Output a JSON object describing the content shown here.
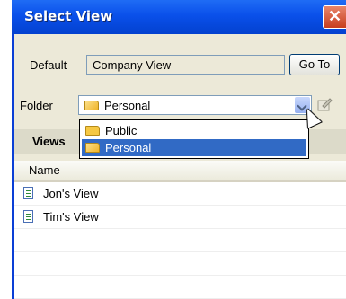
{
  "window": {
    "title": "Select View",
    "close_glyph": "✕"
  },
  "default": {
    "label": "Default",
    "value": "Company View",
    "goto_button": "Go To"
  },
  "folder": {
    "label": "Folder",
    "selected": "Personal",
    "options": [
      {
        "label": "Public"
      },
      {
        "label": "Personal"
      }
    ]
  },
  "views_section": {
    "heading": "Views"
  },
  "list": {
    "column_header": "Name",
    "items": [
      {
        "label": "Jon's View"
      },
      {
        "label": "Tim's View"
      }
    ]
  },
  "icons": {
    "folder": "folder-icon",
    "document": "document-icon",
    "edit": "edit-icon",
    "cursor": "mouse-cursor"
  },
  "colors": {
    "titlebar": "#0a50ea",
    "selection": "#316ac5",
    "dialog_bg": "#ece9d8"
  }
}
